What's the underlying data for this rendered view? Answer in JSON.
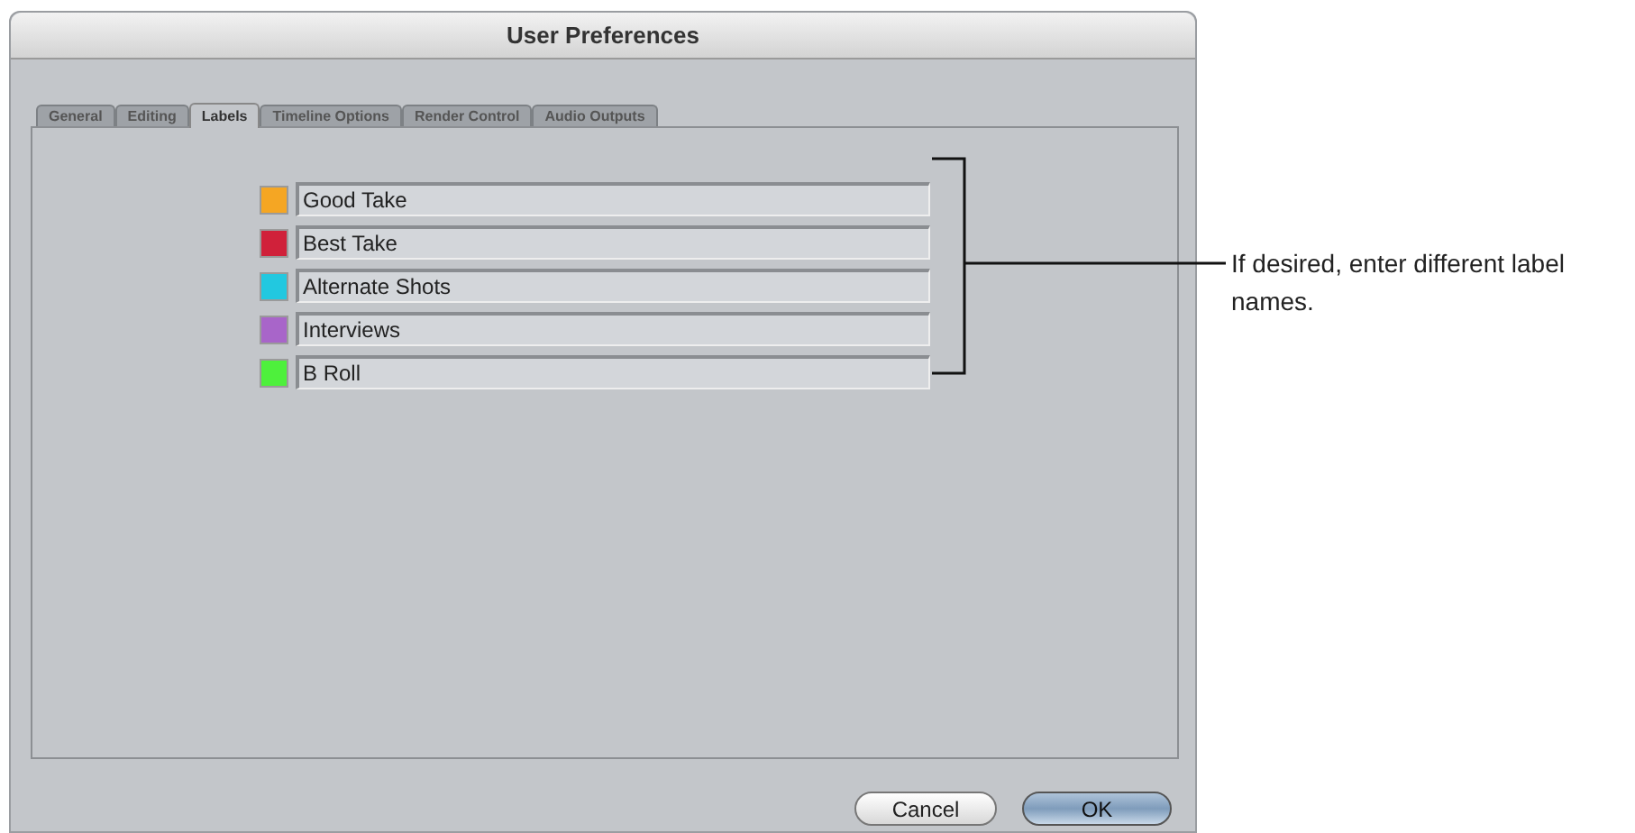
{
  "window": {
    "title": "User Preferences"
  },
  "tabs": [
    {
      "label": "General",
      "selected": false
    },
    {
      "label": "Editing",
      "selected": false
    },
    {
      "label": "Labels",
      "selected": true
    },
    {
      "label": "Timeline Options",
      "selected": false
    },
    {
      "label": "Render Control",
      "selected": false
    },
    {
      "label": "Audio Outputs",
      "selected": false
    }
  ],
  "labels": [
    {
      "name": "Good Take",
      "color": "#f5a623"
    },
    {
      "name": "Best Take",
      "color": "#d0213a"
    },
    {
      "name": "Alternate Shots",
      "color": "#22c8e0"
    },
    {
      "name": "Interviews",
      "color": "#a865c9"
    },
    {
      "name": "B Roll",
      "color": "#4ef03c"
    }
  ],
  "buttons": [
    {
      "label": "Cancel",
      "kind": "normal"
    },
    {
      "label": "OK",
      "kind": "default"
    }
  ],
  "callout": {
    "text": "If desired, enter different label names."
  }
}
